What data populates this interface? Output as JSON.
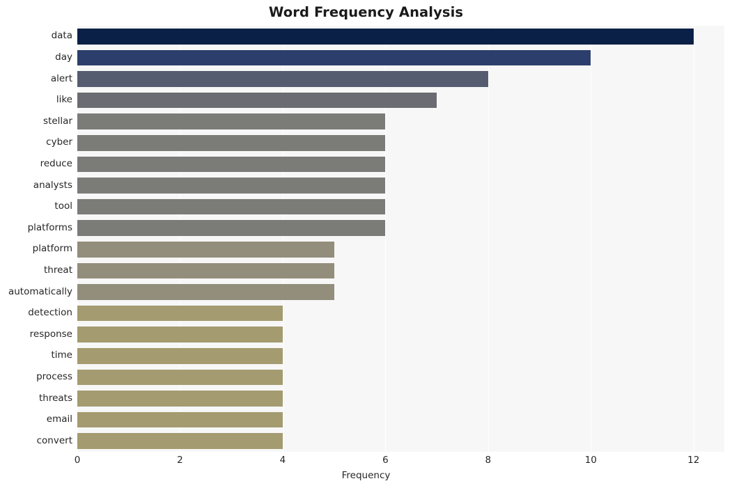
{
  "chart_data": {
    "type": "bar",
    "orientation": "horizontal",
    "title": "Word Frequency Analysis",
    "xlabel": "Frequency",
    "ylabel": "",
    "categories": [
      "data",
      "day",
      "alert",
      "like",
      "stellar",
      "cyber",
      "reduce",
      "analysts",
      "tool",
      "platforms",
      "platform",
      "threat",
      "automatically",
      "detection",
      "response",
      "time",
      "process",
      "threats",
      "email",
      "convert"
    ],
    "values": [
      12,
      10,
      8,
      7,
      6,
      6,
      6,
      6,
      6,
      6,
      5,
      5,
      5,
      4,
      4,
      4,
      4,
      4,
      4,
      4
    ],
    "bar_colors": [
      "#0a2047",
      "#2c3e6b",
      "#565c70",
      "#6b6b73",
      "#7b7b78",
      "#7b7b78",
      "#7b7b78",
      "#7b7b78",
      "#7b7b78",
      "#7b7b78",
      "#938d7c",
      "#938d7c",
      "#938d7c",
      "#a49b71",
      "#a49b71",
      "#a49b71",
      "#a49b71",
      "#a49b71",
      "#a49b71",
      "#a49b71"
    ],
    "xlim": [
      0,
      12.6
    ],
    "xticks": [
      0,
      2,
      4,
      6,
      8,
      10,
      12
    ],
    "xtick_labels": [
      "0",
      "2",
      "4",
      "6",
      "8",
      "10",
      "12"
    ],
    "grid": true,
    "grid_axis": "x",
    "legend": null,
    "plot_background": "#f7f7f7",
    "gridline_color": "#ffffff",
    "figure_background": "#ffffff"
  }
}
